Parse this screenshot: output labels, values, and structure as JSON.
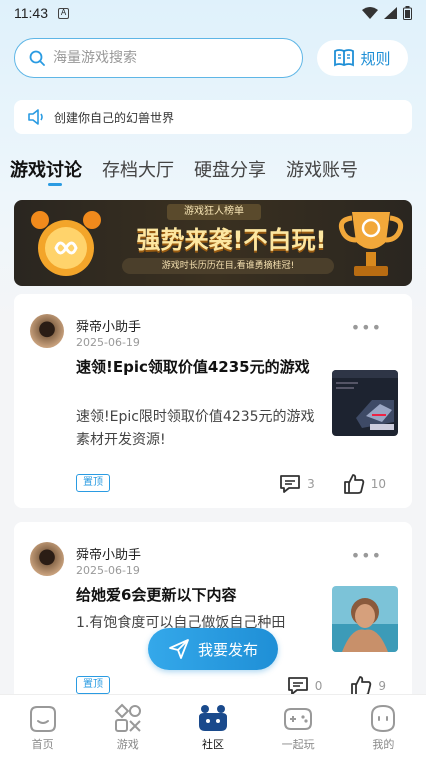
{
  "status_bar": {
    "time": "11:43",
    "app_letter": "A"
  },
  "search": {
    "placeholder": "海量游戏搜索",
    "rules_label": "规则"
  },
  "notice": {
    "text": "创建你自己的幻兽世界"
  },
  "tabs": [
    {
      "label": "游戏讨论",
      "active": true
    },
    {
      "label": "存档大厅",
      "active": false
    },
    {
      "label": "硬盘分享",
      "active": false
    },
    {
      "label": "游戏账号",
      "active": false
    }
  ],
  "banner": {
    "tag": "游戏狂人榜单",
    "headline": "强势来袭!不白玩!",
    "sub": "游戏时长历历在目,看谁勇摘桂冠!"
  },
  "posts": [
    {
      "author": "舜帝小助手",
      "date": "2025-06-19",
      "title": "速领!Epic领取价值4235元的游戏",
      "body": "速领!Epic限时领取价值4235元的游戏素材开发资源!",
      "pin_label": "置顶",
      "comments": "3",
      "likes": "10"
    },
    {
      "author": "舜帝小助手",
      "date": "2025-06-19",
      "title": "给她爱6会更新以下内容",
      "body": "1.有饱食度可以自己做饭自己种田",
      "pin_label": "置顶",
      "comments": "0",
      "likes": "9"
    }
  ],
  "publish_button": {
    "label": "我要发布"
  },
  "bottom_nav": [
    {
      "label": "首页",
      "icon": "home-icon",
      "active": false
    },
    {
      "label": "游戏",
      "icon": "game-shapes-icon",
      "active": false
    },
    {
      "label": "社区",
      "icon": "community-icon",
      "active": true
    },
    {
      "label": "一起玩",
      "icon": "gamepad-icon",
      "active": false
    },
    {
      "label": "我的",
      "icon": "profile-icon",
      "active": false
    }
  ],
  "colors": {
    "accent": "#2a9be2",
    "banner_bg": "#2a2620"
  }
}
